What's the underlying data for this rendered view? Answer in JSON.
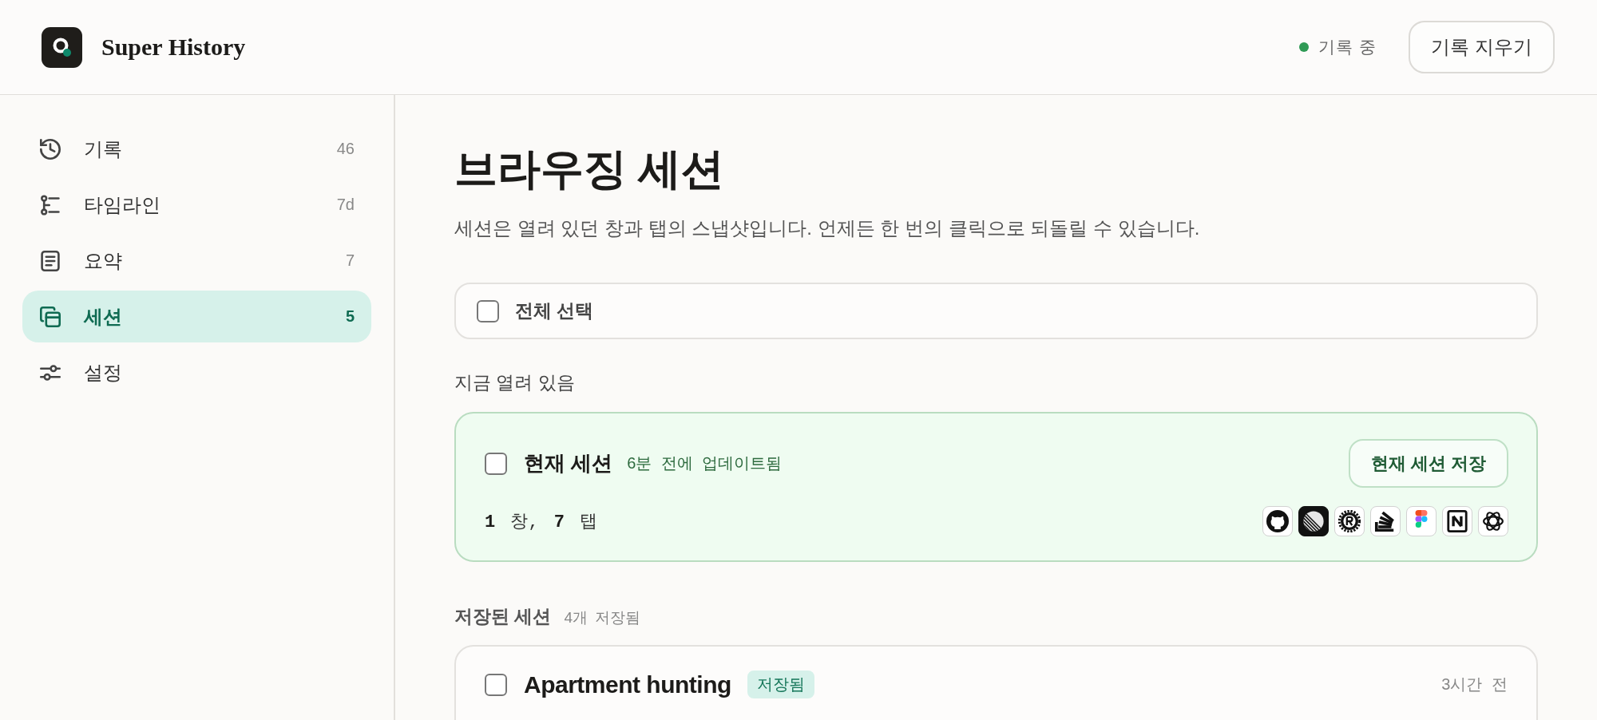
{
  "app": {
    "title": "Super History"
  },
  "header": {
    "status": {
      "label": "기록 중",
      "active": true
    },
    "clear_button": "기록 지우기"
  },
  "sidebar": {
    "items": [
      {
        "label": "기록",
        "count": "46",
        "selected": false
      },
      {
        "label": "타임라인",
        "count": "7d",
        "selected": false
      },
      {
        "label": "요약",
        "count": "7",
        "selected": false
      },
      {
        "label": "세션",
        "count": "5",
        "selected": true
      },
      {
        "label": "설정",
        "selected": false
      }
    ]
  },
  "page": {
    "title": "브라우징 세션",
    "description": "세션은 열려 있던 창과 탭의 스냅샷입니다. 언제든 한 번의 클릭으로 되돌릴 수 있습니다."
  },
  "select_all": {
    "label": "전체 선택",
    "checked": false
  },
  "open_section": {
    "heading": "지금 열려 있음",
    "session": {
      "title": "현재 세션",
      "updated": "6분 전에 업데이트됨",
      "checked": false,
      "counts": "**1** 창, **7** 탭",
      "save_button": "현재 세션 저장"
    }
  },
  "saved_section": {
    "heading": "저장된 세션",
    "count": "4개 저장됨",
    "sessions": [
      {
        "title": "Apartment hunting",
        "badge": "저장됨",
        "time": "3시간 전",
        "checked": false
      }
    ]
  }
}
